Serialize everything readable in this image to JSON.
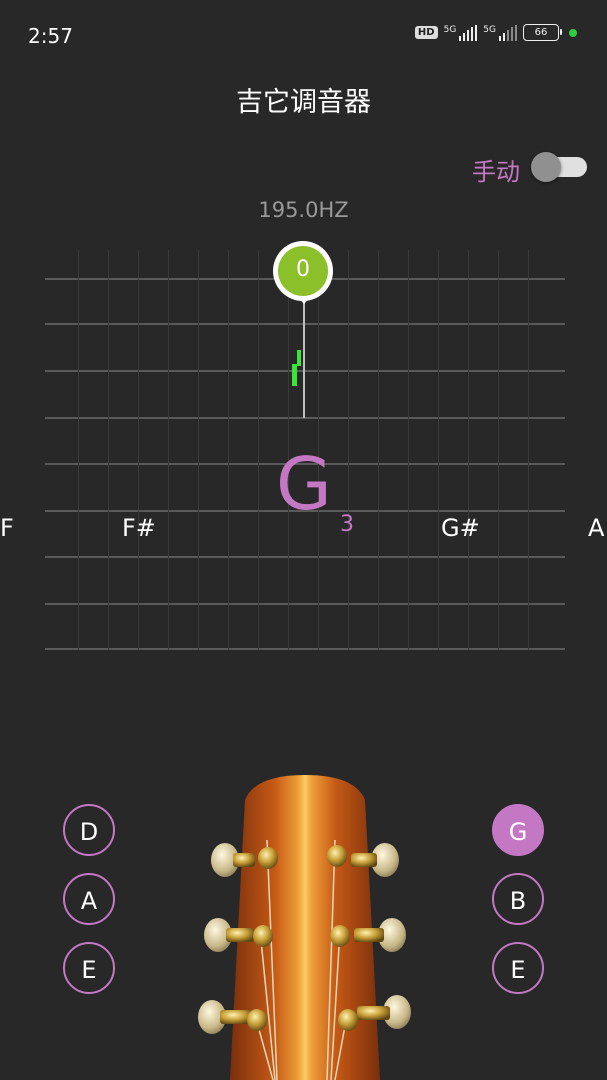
{
  "status_bar": {
    "time": "2:57",
    "hd_label": "HD",
    "network_1": "5G",
    "network_2": "5G",
    "battery": "66"
  },
  "header": {
    "title": "吉它调音器"
  },
  "manual_toggle": {
    "label": "手动",
    "on": false
  },
  "frequency": "195.0HZ",
  "needle": {
    "value": "0"
  },
  "note_display": {
    "note": "G",
    "octave": "3"
  },
  "neighbor_notes": [
    "F",
    "F#",
    "G#",
    "A"
  ],
  "strings": {
    "left": [
      "D",
      "A",
      "E"
    ],
    "right": [
      "G",
      "B",
      "E"
    ],
    "selected": "G"
  },
  "colors": {
    "accent": "#c478c4",
    "indicator": "#8bc02a",
    "level_bar": "#37e637",
    "background": "#282828"
  }
}
